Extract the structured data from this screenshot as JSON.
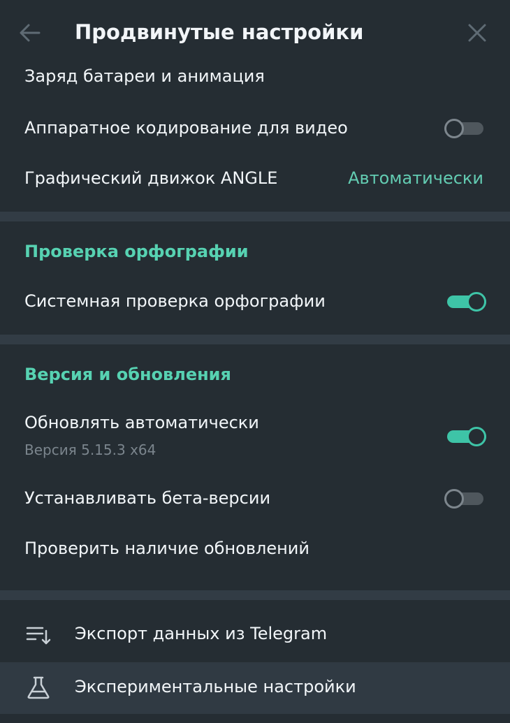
{
  "header": {
    "title": "Продвинутые настройки",
    "back_icon": "arrow-left-icon",
    "close_icon": "close-icon"
  },
  "performance": {
    "battery_label": "Заряд батареи и анимация",
    "hw_encoding_label": "Аппаратное кодирование для видео",
    "hw_encoding_enabled": false,
    "angle_label": "Графический движок ANGLE",
    "angle_value": "Автоматически"
  },
  "spellcheck": {
    "section_title": "Проверка орфографии",
    "system_label": "Системная проверка орфографии",
    "system_enabled": true
  },
  "updates": {
    "section_title": "Версия и обновления",
    "auto_update_label": "Обновлять автоматически",
    "version_text": "Версия 5.15.3 x64",
    "auto_update_enabled": true,
    "beta_label": "Устанавливать бета-версии",
    "beta_enabled": false,
    "check_label": "Проверить наличие обновлений"
  },
  "menu": {
    "export_label": "Экспорт данных из Telegram",
    "export_icon": "export-list-icon",
    "experimental_label": "Экспериментальные настройки",
    "experimental_icon": "flask-icon"
  },
  "colors": {
    "background": "#252d33",
    "separator": "#323c45",
    "accent": "#3ec4a7",
    "section_title": "#57d2b2",
    "hover": "#303a43"
  }
}
